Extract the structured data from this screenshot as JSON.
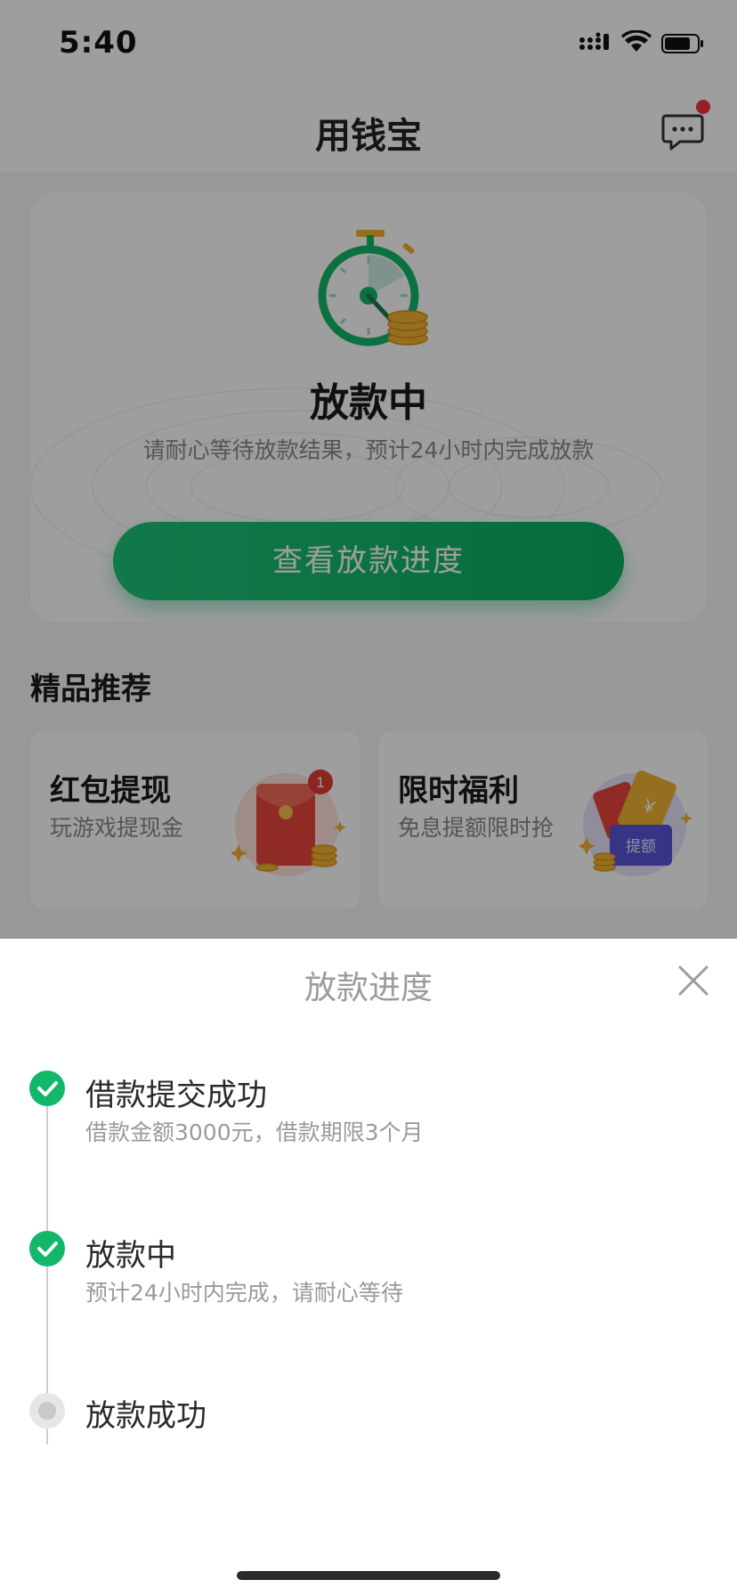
{
  "status_bar": {
    "time": "5:40"
  },
  "nav": {
    "title": "用钱宝",
    "message_icon": "chat-bubble-icon",
    "has_unread": true
  },
  "status_card": {
    "icon": "stopwatch-coins-icon",
    "title": "放款中",
    "description": "请耐心等待放款结果，预计24小时内完成放款",
    "button_label": "查看放款进度"
  },
  "recommend": {
    "section_title": "精品推荐",
    "cards": [
      {
        "title": "红包提现",
        "subtitle": "玩游戏提现金",
        "icon": "red-envelope-icon",
        "badge": "1"
      },
      {
        "title": "限时福利",
        "subtitle": "免息提额限时抢",
        "icon": "coupon-tickets-icon",
        "tag": "提额"
      }
    ]
  },
  "sheet": {
    "title": "放款进度",
    "close_icon": "close-icon",
    "steps": [
      {
        "title": "借款提交成功",
        "desc": "借款金额3000元，借款期限3个月",
        "state": "done"
      },
      {
        "title": "放款中",
        "desc": "预计24小时内完成，请耐心等待",
        "state": "done"
      },
      {
        "title": "放款成功",
        "desc": "",
        "state": "pending"
      }
    ]
  },
  "colors": {
    "accent": "#12b76a",
    "badge": "#f2353a",
    "overlay": "rgba(0,0,0,0.38)"
  }
}
